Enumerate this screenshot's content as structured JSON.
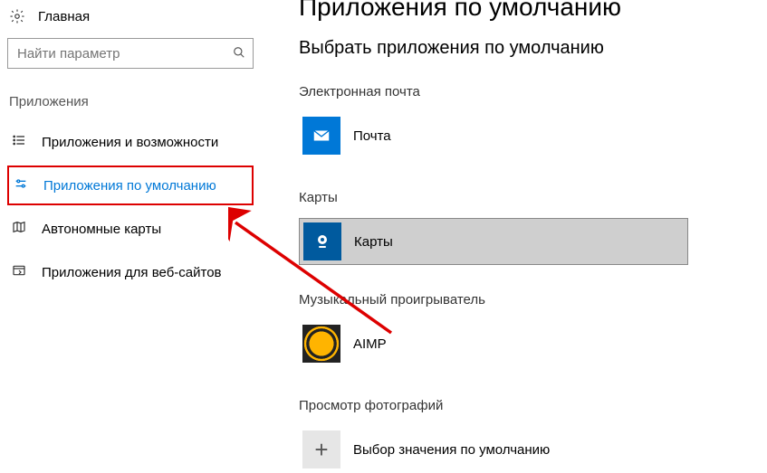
{
  "sidebar": {
    "home": "Главная",
    "search_placeholder": "Найти параметр",
    "section": "Приложения",
    "items": [
      {
        "label": "Приложения и возможности"
      },
      {
        "label": "Приложения по умолчанию"
      },
      {
        "label": "Автономные карты"
      },
      {
        "label": "Приложения для веб-сайтов"
      }
    ]
  },
  "main": {
    "title": "Приложения по умолчанию",
    "subtitle": "Выбрать приложения по умолчанию",
    "categories": [
      {
        "label": "Электронная почта",
        "app": "Почта"
      },
      {
        "label": "Карты",
        "app": "Карты"
      },
      {
        "label": "Музыкальный проигрыватель",
        "app": "AIMP"
      },
      {
        "label": "Просмотр фотографий",
        "app": "Выбор значения по умолчанию"
      }
    ]
  }
}
